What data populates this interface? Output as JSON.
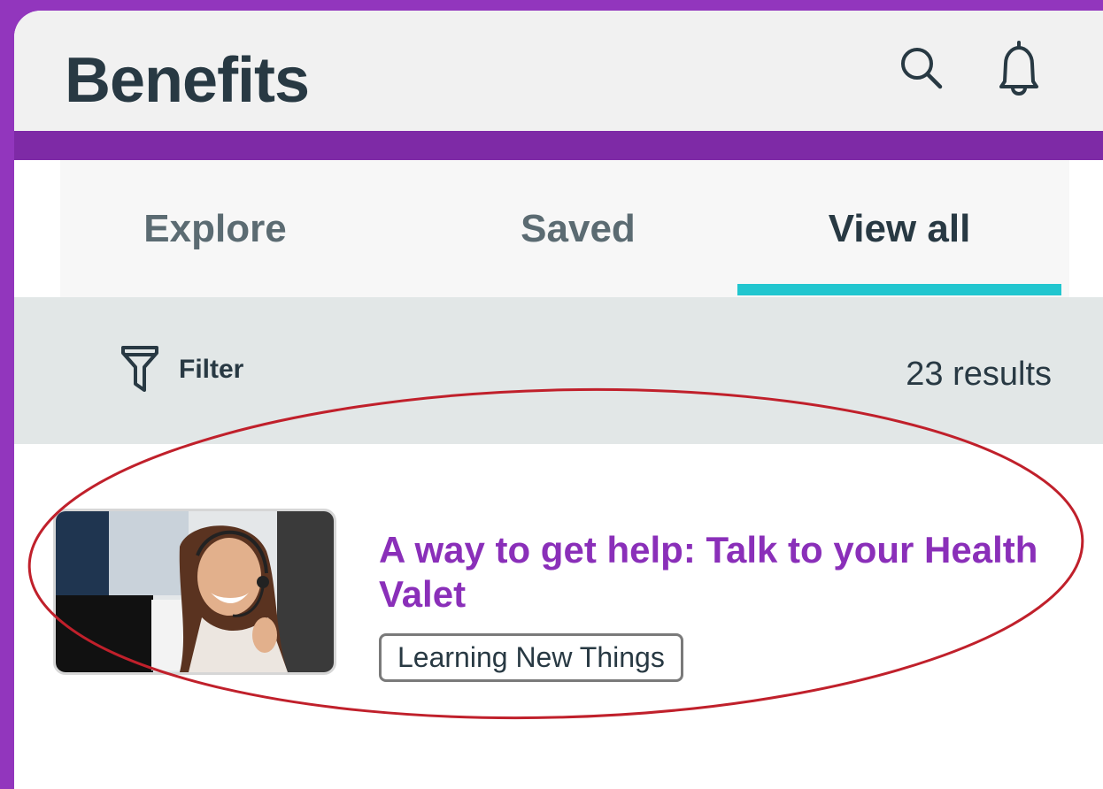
{
  "header": {
    "title": "Benefits",
    "search_icon": "search-icon",
    "bell_icon": "bell-icon"
  },
  "tabs": [
    {
      "label": "Explore",
      "selected": false
    },
    {
      "label": "Saved",
      "selected": false
    },
    {
      "label": "View all",
      "selected": true
    }
  ],
  "filter_bar": {
    "filter_label": "Filter",
    "filter_icon": "funnel-icon",
    "results_text": "23 results"
  },
  "results": [
    {
      "title": "A way to get help: Talk to your Health Valet",
      "tag": "Learning New Things",
      "thumbnail": "photo of smiling woman wearing headset"
    }
  ],
  "colors": {
    "brand_purple": "#9236bd",
    "band_purple": "#7e2aa6",
    "title_purple": "#8a2fb9",
    "tab_accent": "#21c6cf",
    "dark_text": "#283943",
    "annotation_red": "#c0202b"
  }
}
